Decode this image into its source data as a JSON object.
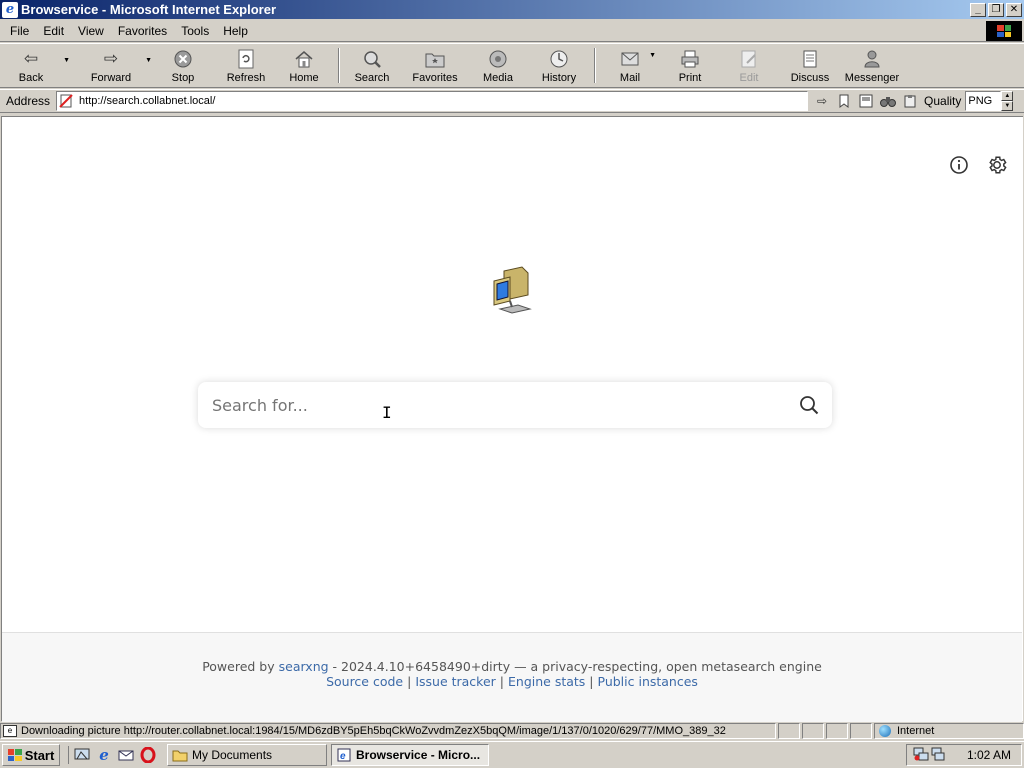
{
  "window": {
    "title": "Browservice - Microsoft Internet Explorer"
  },
  "menubar": {
    "items": [
      "File",
      "Edit",
      "View",
      "Favorites",
      "Tools",
      "Help"
    ]
  },
  "toolbar": {
    "back": "Back",
    "forward": "Forward",
    "stop": "Stop",
    "refresh": "Refresh",
    "home": "Home",
    "search": "Search",
    "favorites": "Favorites",
    "media": "Media",
    "history": "History",
    "mail": "Mail",
    "print": "Print",
    "edit": "Edit",
    "discuss": "Discuss",
    "messenger": "Messenger"
  },
  "addressbar": {
    "label": "Address",
    "url": "http://search.collabnet.local/",
    "quality_label": "Quality",
    "quality_value": "PNG"
  },
  "page": {
    "search_placeholder": "Search for...",
    "footer": {
      "powered_by": "Powered by",
      "engine_link": "searxng",
      "version_text": "- 2024.4.10+6458490+dirty — a privacy-respecting, open metasearch engine",
      "links": [
        "Source code",
        "Issue tracker",
        "Engine stats",
        "Public instances"
      ],
      "separator": "|"
    }
  },
  "statusbar": {
    "text": "Downloading picture http://router.collabnet.local:1984/15/MD6zdBY5pEh5bqCkWoZvvdmZezX5bqQM/image/1/137/0/1020/629/77/MMO_389_32",
    "zone": "Internet"
  },
  "taskbar": {
    "start": "Start",
    "tasks": [
      "My Documents",
      "Browservice - Micro..."
    ],
    "clock": "1:02 AM"
  },
  "colors": {
    "title_gradient_start": "#0a246a",
    "title_gradient_end": "#a6caf0",
    "link": "#3c6aa8",
    "chrome": "#d4d0c8"
  }
}
